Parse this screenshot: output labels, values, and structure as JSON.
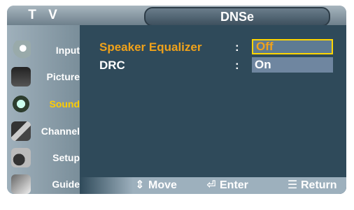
{
  "header": {
    "left_title": "T V",
    "title": "DNSe"
  },
  "sidebar": {
    "items": [
      {
        "label": "Input",
        "icon": "input-icon",
        "active": false
      },
      {
        "label": "Picture",
        "icon": "picture-icon",
        "active": false
      },
      {
        "label": "Sound",
        "icon": "sound-icon",
        "active": true
      },
      {
        "label": "Channel",
        "icon": "channel-icon",
        "active": false
      },
      {
        "label": "Setup",
        "icon": "setup-icon",
        "active": false
      },
      {
        "label": "Guide",
        "icon": "guide-icon",
        "active": false
      }
    ]
  },
  "menu": {
    "rows": [
      {
        "label": "Speaker Equalizer",
        "colon": ":",
        "value": "Off",
        "selected": true
      },
      {
        "label": "DRC",
        "colon": ":",
        "value": "On",
        "selected": false
      }
    ]
  },
  "footer": {
    "move_label": "Move",
    "enter_label": "Enter",
    "return_label": "Return"
  },
  "colors": {
    "selected_text": "#f0a21a",
    "selected_border": "#ffd600",
    "panel_bg": "#2f4a5a"
  }
}
